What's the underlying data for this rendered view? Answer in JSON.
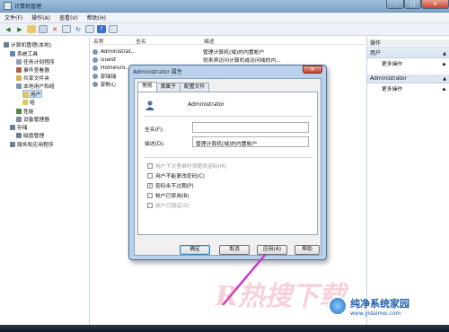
{
  "window": {
    "title": "计算机管理",
    "min": "–",
    "max": "□",
    "close": "✕"
  },
  "menu": [
    "文件(F)",
    "操作(A)",
    "查看(V)",
    "帮助(H)"
  ],
  "tree": [
    {
      "label": "计算机管理(本地)",
      "indent": 0,
      "color": "#6b7f99"
    },
    {
      "label": "系统工具",
      "indent": 1,
      "color": "#5b87b5"
    },
    {
      "label": "任务计划程序",
      "indent": 2,
      "color": "#8aa0b8"
    },
    {
      "label": "事件查看器",
      "indent": 2,
      "color": "#b35a4c"
    },
    {
      "label": "共享文件夹",
      "indent": 2,
      "color": "#d8b04a"
    },
    {
      "label": "本地用户和组",
      "indent": 2,
      "color": "#7d94b2"
    },
    {
      "label": "用户",
      "indent": 3,
      "color": "#e7c35a"
    },
    {
      "label": "组",
      "indent": 3,
      "color": "#e7c35a"
    },
    {
      "label": "性能",
      "indent": 2,
      "color": "#4f8b3f"
    },
    {
      "label": "设备管理器",
      "indent": 2,
      "color": "#7d8fa6"
    },
    {
      "label": "存储",
      "indent": 1,
      "color": "#6b7f99"
    },
    {
      "label": "磁盘管理",
      "indent": 2,
      "color": "#6b7f99"
    },
    {
      "label": "服务和应用程序",
      "indent": 1,
      "color": "#6b7f99"
    }
  ],
  "list": {
    "headers": [
      "名称",
      "全名",
      "描述"
    ],
    "rows": [
      {
        "name": "Administrat...",
        "full": "",
        "desc": "管理计算机(域)的内置帐户"
      },
      {
        "name": "Guest",
        "full": "",
        "desc": "供来宾访问计算机或访问域的内..."
      },
      {
        "name": "HomeGro...",
        "full": "",
        "desc": ""
      },
      {
        "name": "郭瑞瑞",
        "full": "",
        "desc": ""
      },
      {
        "name": "郭鲛心",
        "full": "",
        "desc": ""
      }
    ]
  },
  "actions": {
    "header": "操作",
    "sections": [
      {
        "title": "用户",
        "item": "更多操作"
      },
      {
        "title": "Administrator",
        "item": "更多操作"
      }
    ]
  },
  "dialog": {
    "title": "Administrator 属性",
    "close": "✕",
    "tabs": [
      "常规",
      "隶属于",
      "配置文件"
    ],
    "username": "Administrator",
    "fullname_label": "全名(F):",
    "fullname_value": "",
    "desc_label": "描述(D):",
    "desc_value": "管理计算机(域)的内置帐户",
    "checks": [
      {
        "label": "用户下次登录时须更改密码(M)",
        "checked": false,
        "disabled": true
      },
      {
        "label": "用户不能更改密码(C)",
        "checked": false,
        "disabled": false
      },
      {
        "label": "密码永不过期(P)",
        "checked": true,
        "disabled": false
      },
      {
        "label": "帐户已禁用(B)",
        "checked": false,
        "disabled": false
      },
      {
        "label": "帐户已锁定(O)",
        "checked": false,
        "disabled": true
      }
    ],
    "buttons": {
      "ok": "确定",
      "cancel": "取消",
      "apply": "应用(A)",
      "help": "帮助"
    }
  },
  "watermark": {
    "text": "R热搜下载",
    "logo_title": "纯净系统家园",
    "logo_url": "www.yidaimei.com"
  },
  "colors": {
    "accent": "#3c7fb1",
    "title_bar": "#9fbfdc",
    "annotation": "#c43cc8"
  }
}
